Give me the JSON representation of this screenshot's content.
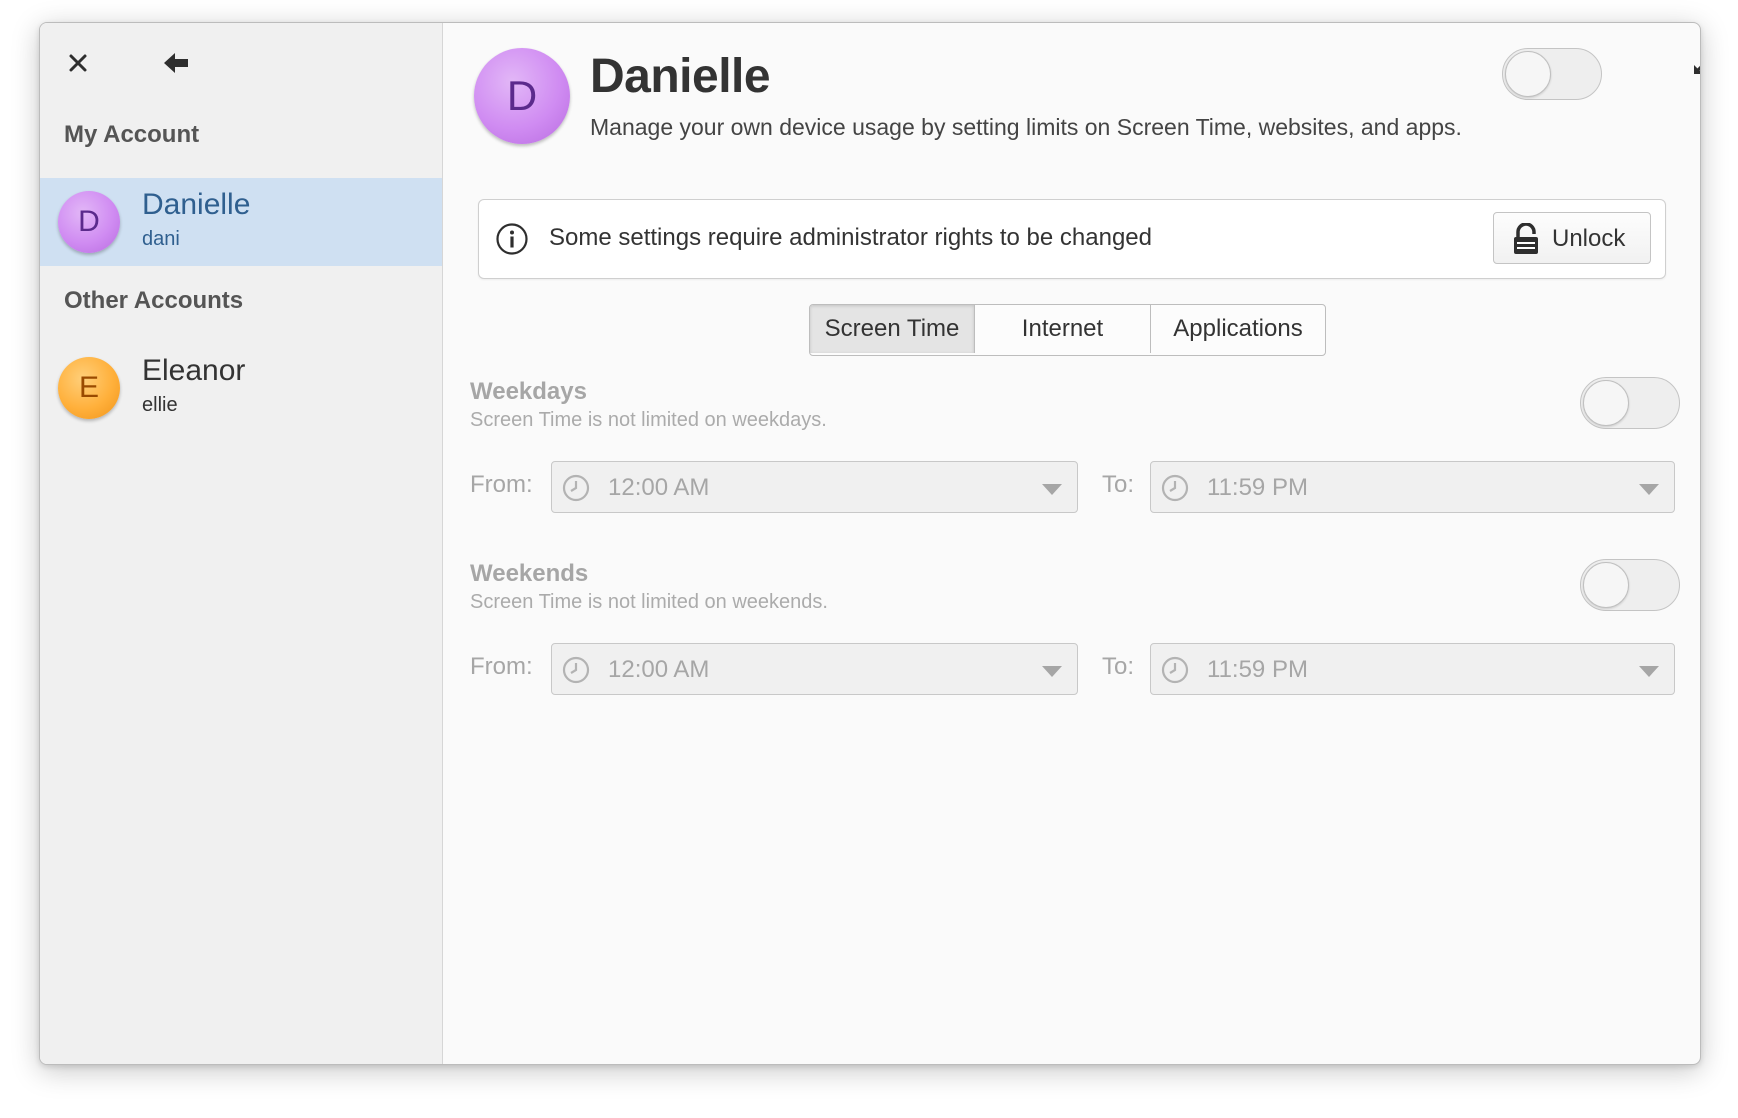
{
  "sidebar": {
    "my_account_header": "My Account",
    "other_accounts_header": "Other Accounts",
    "accounts": [
      {
        "initial": "D",
        "name": "Danielle",
        "username": "dani",
        "color": "#d08cf2",
        "selected": true
      },
      {
        "initial": "E",
        "name": "Eleanor",
        "username": "ellie",
        "color": "#ffb03b",
        "selected": false
      }
    ],
    "icons": {
      "close": "close-icon",
      "back": "back-arrow-icon"
    }
  },
  "header": {
    "avatar_initial": "D",
    "title": "Danielle",
    "subtitle": "Manage your own device usage by setting limits on Screen Time, websites, and apps.",
    "toggle_on": false
  },
  "infobar": {
    "message": "Some settings require administrator rights to be changed",
    "unlock_label": "Unlock"
  },
  "tabs": [
    {
      "label": "Screen Time",
      "active": true
    },
    {
      "label": "Internet",
      "active": false
    },
    {
      "label": "Applications",
      "active": false
    }
  ],
  "weekdays": {
    "title": "Weekdays",
    "description": "Screen Time is not limited on weekdays.",
    "enabled": false,
    "from_label": "From:",
    "from_value": "12:00 AM",
    "to_label": "To:",
    "to_value": "11:59 PM"
  },
  "weekends": {
    "title": "Weekends",
    "description": "Screen Time is not limited on weekends.",
    "enabled": false,
    "from_label": "From:",
    "from_value": "12:00 AM",
    "to_label": "To:",
    "to_value": "11:59 PM"
  },
  "colors": {
    "selection": "#cfe0f2",
    "selected_text": "#2f5f8f",
    "disabled_text": "#a6a6a6"
  }
}
